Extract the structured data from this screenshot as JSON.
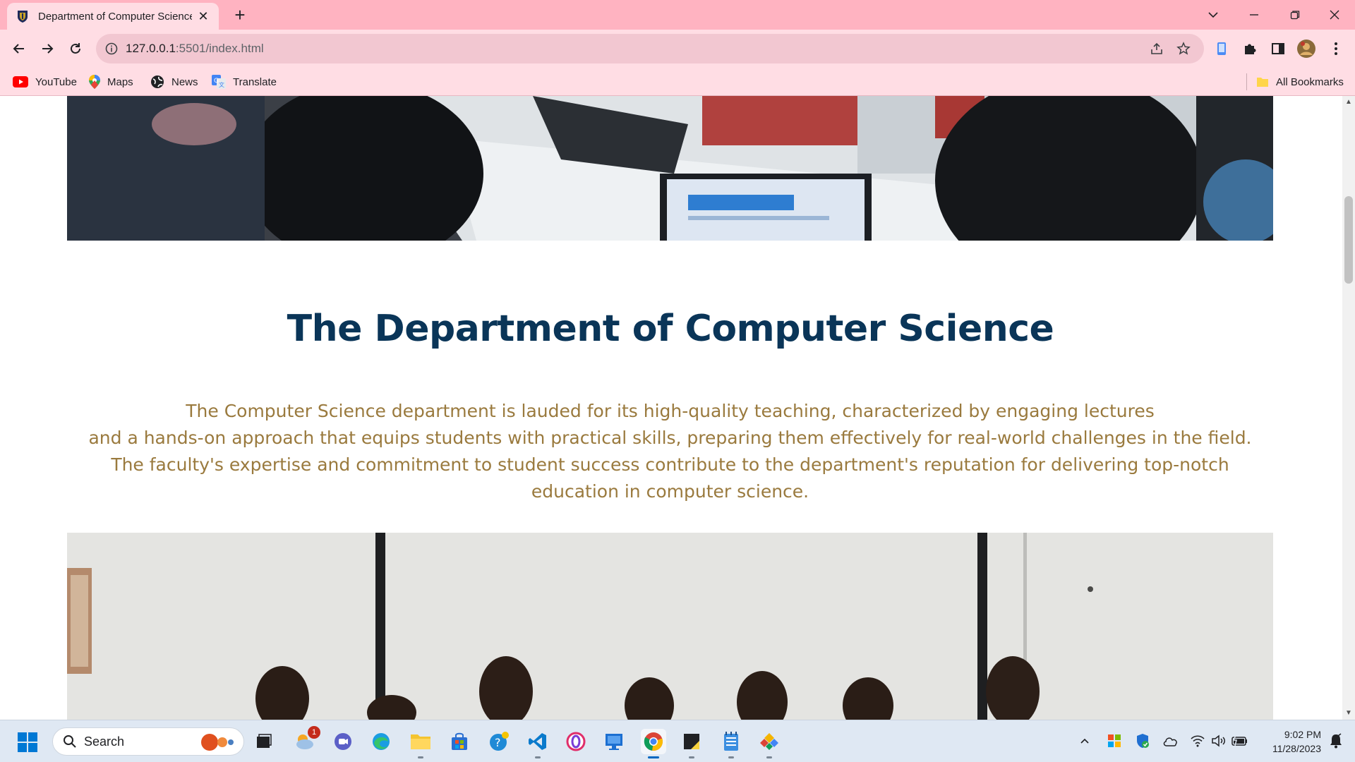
{
  "browser": {
    "tab": {
      "title": "Department of Computer Science",
      "close_glyph": "✕"
    },
    "new_tab_glyph": "+",
    "window_controls": {
      "tab_search": "⌄",
      "minimize": "—",
      "restore": "❐",
      "close": "✕"
    },
    "address": {
      "host": "127.0.0.1",
      "path": ":5501/index.html"
    },
    "bookmarks": [
      {
        "label": "YouTube",
        "icon": "youtube-icon"
      },
      {
        "label": "Maps",
        "icon": "maps-pin-icon"
      },
      {
        "label": "News",
        "icon": "news-globe-icon"
      },
      {
        "label": "Translate",
        "icon": "translate-icon"
      }
    ],
    "all_bookmarks_label": "All Bookmarks"
  },
  "page": {
    "section_title": "The Department of Computer Science",
    "description_lines": [
      "The Computer Science department is lauded for its high-quality teaching, characterized by engaging lectures",
      "and a hands-on approach that equips students with practical skills, preparing them effectively for real-world challenges in the field.",
      "The faculty's expertise and commitment to student success contribute to the department's reputation for delivering top-notch",
      "education in computer science."
    ]
  },
  "taskbar": {
    "search_label": "Search",
    "notification_badge": "1",
    "clock_time": "9:02 PM",
    "clock_date": "11/28/2023"
  },
  "colors": {
    "tab_strip": "#ffb3c1",
    "toolbar": "#ffdde4",
    "title": "#0a3558",
    "description": "#9a7a3e"
  }
}
